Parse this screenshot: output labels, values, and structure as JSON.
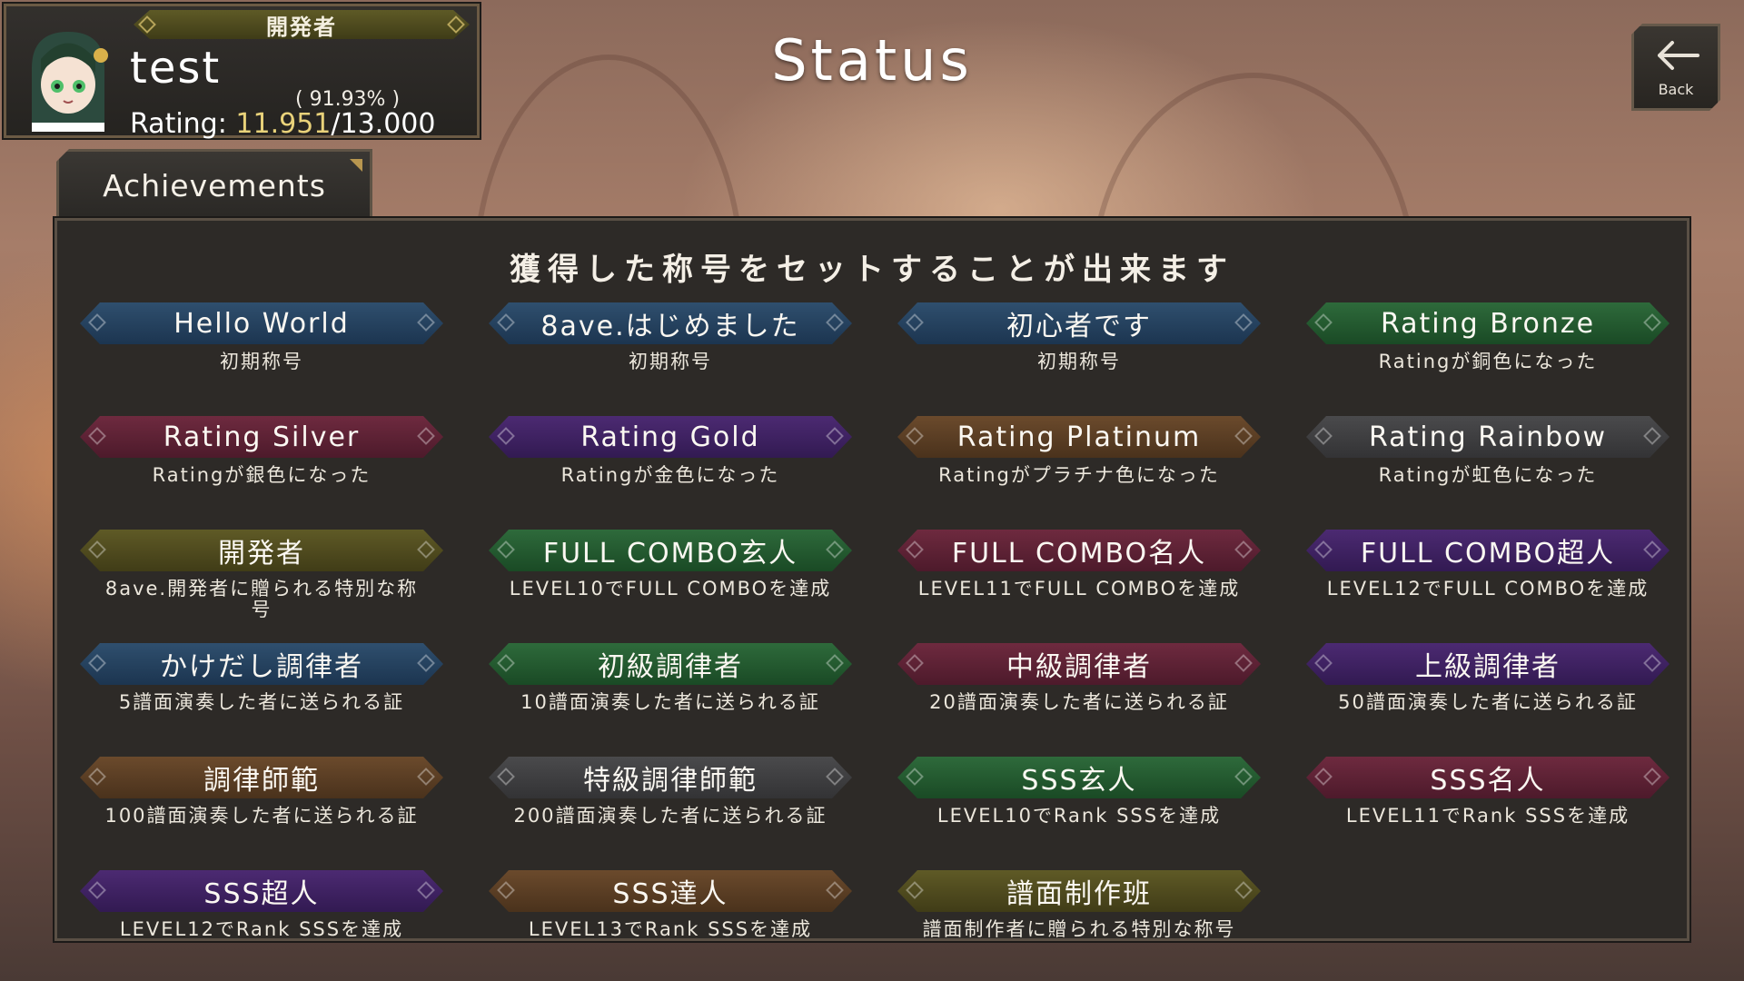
{
  "profile": {
    "title_badge": "開発者",
    "player_name": "test",
    "rating_percent": "( 91.93% )",
    "rating_label": "Rating:",
    "rating_current": "11.951",
    "rating_max": "/13.000"
  },
  "header": {
    "title": "Status"
  },
  "back_button": {
    "label": "Back"
  },
  "tabs": [
    {
      "label": "Achievements"
    }
  ],
  "panel": {
    "heading": "獲得した称号をセットすることが出来ます",
    "achievements": [
      {
        "name": "Hello World",
        "desc": "初期称号",
        "color": "blue"
      },
      {
        "name": "8ave.はじめました",
        "desc": "初期称号",
        "color": "blue"
      },
      {
        "name": "初心者です",
        "desc": "初期称号",
        "color": "blue"
      },
      {
        "name": "Rating Bronze",
        "desc": "Ratingが銅色になった",
        "color": "green"
      },
      {
        "name": "Rating Silver",
        "desc": "Ratingが銀色になった",
        "color": "red"
      },
      {
        "name": "Rating Gold",
        "desc": "Ratingが金色になった",
        "color": "purple"
      },
      {
        "name": "Rating Platinum",
        "desc": "Ratingがプラチナ色になった",
        "color": "orange"
      },
      {
        "name": "Rating Rainbow",
        "desc": "Ratingが虹色になった",
        "color": "gray"
      },
      {
        "name": "開発者",
        "desc": "8ave.開発者に贈られる特別な称号",
        "color": "olive"
      },
      {
        "name": "FULL COMBO玄人",
        "desc": "LEVEL10でFULL COMBOを達成",
        "color": "green"
      },
      {
        "name": "FULL COMBO名人",
        "desc": "LEVEL11でFULL COMBOを達成",
        "color": "red"
      },
      {
        "name": "FULL COMBO超人",
        "desc": "LEVEL12でFULL COMBOを達成",
        "color": "purple"
      },
      {
        "name": "かけだし調律者",
        "desc": "5譜面演奏した者に送られる証",
        "color": "blue"
      },
      {
        "name": "初級調律者",
        "desc": "10譜面演奏した者に送られる証",
        "color": "green"
      },
      {
        "name": "中級調律者",
        "desc": "20譜面演奏した者に送られる証",
        "color": "red"
      },
      {
        "name": "上級調律者",
        "desc": "50譜面演奏した者に送られる証",
        "color": "purple"
      },
      {
        "name": "調律師範",
        "desc": "100譜面演奏した者に送られる証",
        "color": "orange"
      },
      {
        "name": "特級調律師範",
        "desc": "200譜面演奏した者に送られる証",
        "color": "gray"
      },
      {
        "name": "SSS玄人",
        "desc": "LEVEL10でRank SSSを達成",
        "color": "green"
      },
      {
        "name": "SSS名人",
        "desc": "LEVEL11でRank SSSを達成",
        "color": "red"
      },
      {
        "name": "SSS超人",
        "desc": "LEVEL12でRank SSSを達成",
        "color": "purple"
      },
      {
        "name": "SSS達人",
        "desc": "LEVEL13でRank SSSを達成",
        "color": "orange"
      },
      {
        "name": "譜面制作班",
        "desc": "譜面制作者に贈られる特別な称号",
        "color": "olive"
      }
    ]
  },
  "colors": {
    "blue": "#2f4f6e",
    "green": "#2e6a3b",
    "red": "#6e2a3f",
    "purple": "#4c2a72",
    "orange": "#6b4a2c",
    "gray": "#4a4a4c",
    "olive": "#5f5a26",
    "rating_gold": "#e9d27a"
  }
}
